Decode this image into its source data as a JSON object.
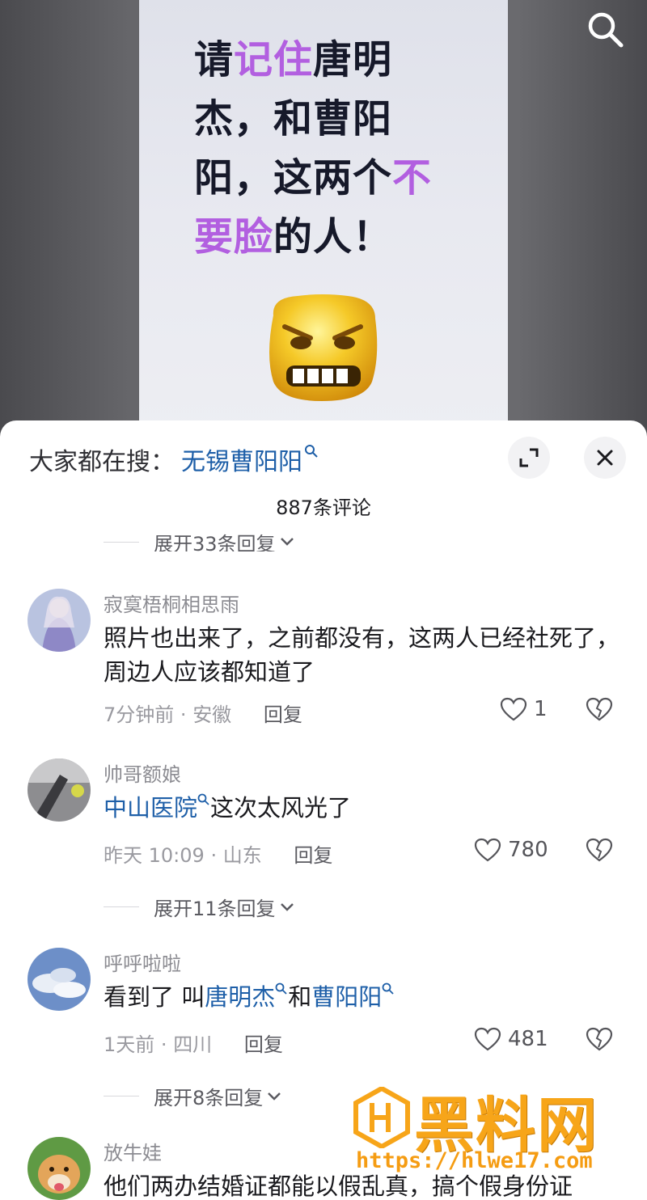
{
  "video": {
    "title_segments": [
      {
        "text": "请",
        "hl": false
      },
      {
        "text": "记住",
        "hl": true
      },
      {
        "text": "唐明杰，和曹阳阳，这两个",
        "hl": false
      },
      {
        "text": "不要脸",
        "hl": true
      },
      {
        "text": "的人！",
        "hl": false
      }
    ],
    "highlight_color": "#b25fe0",
    "emoji": "angry-face-icon"
  },
  "panel": {
    "suggest_prefix": "大家都在搜：",
    "suggest_link": "无锡曹阳阳",
    "comment_count": "887条评论",
    "top_reply_toggle": "展开33条回复"
  },
  "comments": [
    {
      "username": "寂寞梧桐相思雨",
      "text": "照片也出来了，之前都没有，这两人已经社死了，周边人应该都知道了",
      "time": "7分钟前",
      "location": "安徽",
      "reply_label": "回复",
      "likes": "1"
    },
    {
      "username": "帅哥额娘",
      "link": "中山医院",
      "text": "这次太风光了",
      "time": "昨天 10:09",
      "location": "山东",
      "reply_label": "回复",
      "likes": "780",
      "reply_toggle": "展开11条回复"
    },
    {
      "username": "呼呼啦啦",
      "text_prefix": "看到了 叫",
      "link1": "唐明杰",
      "text_middle": "和",
      "link2": "曹阳阳",
      "time": "1天前",
      "location": "四川",
      "reply_label": "回复",
      "likes": "481",
      "reply_toggle": "展开8条回复"
    },
    {
      "username": "放牛娃",
      "text": "他们两办结婚证都能以假乱真，搞个假身份证"
    }
  ],
  "watermark": {
    "text": "黑料网",
    "url": "https://hlwe17.com"
  },
  "colors": {
    "link": "#1e5fa8",
    "watermark": "#f7a519"
  }
}
